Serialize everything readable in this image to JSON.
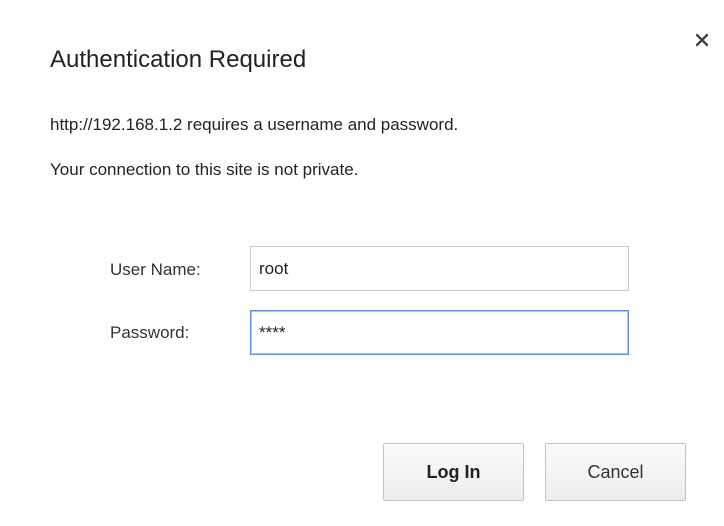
{
  "dialog": {
    "title": "Authentication Required",
    "message_line1": "http://192.168.1.2 requires a username and password.",
    "message_line2": "Your connection to this site is not private.",
    "close_icon": "close-icon"
  },
  "form": {
    "username_label": "User Name:",
    "username_value": "root",
    "password_label": "Password:",
    "password_value": "****"
  },
  "buttons": {
    "login_label": "Log In",
    "cancel_label": "Cancel"
  },
  "colors": {
    "focus_border": "#4d90fe",
    "input_border": "#c8c8c8",
    "text": "#222222"
  }
}
